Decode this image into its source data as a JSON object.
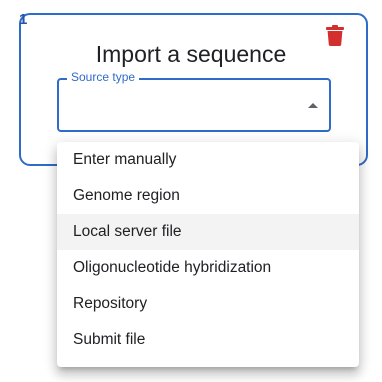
{
  "card": {
    "number": "1",
    "title": "Import a sequence",
    "delete_icon": "trash-icon",
    "delete_color": "#d32f2f",
    "accent": "#2f6bc8"
  },
  "source_type": {
    "label": "Source type",
    "value": "",
    "arrow_icon": "arrow-up-icon"
  },
  "menu": {
    "items": [
      {
        "label": "Enter manually",
        "highlighted": false
      },
      {
        "label": "Genome region",
        "highlighted": false
      },
      {
        "label": "Local server file",
        "highlighted": true
      },
      {
        "label": "Oligonucleotide hybridization",
        "highlighted": false
      },
      {
        "label": "Repository",
        "highlighted": false
      },
      {
        "label": "Submit file",
        "highlighted": false
      }
    ]
  }
}
